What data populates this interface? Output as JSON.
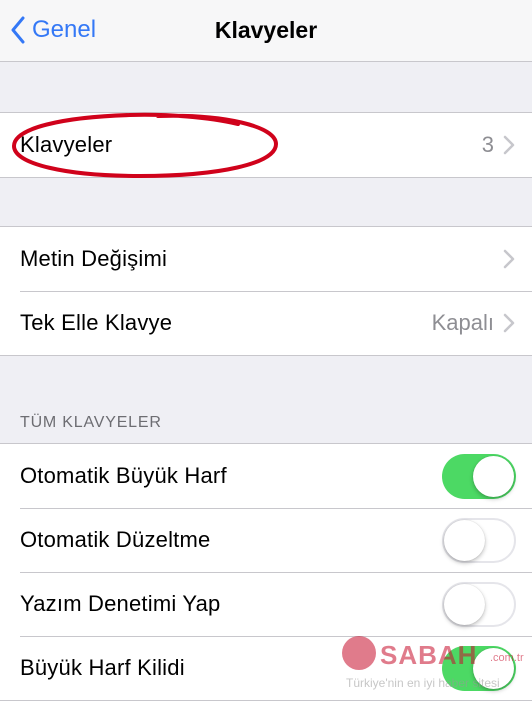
{
  "navbar": {
    "back_label": "Genel",
    "title": "Klavyeler"
  },
  "group1": {
    "rows": [
      {
        "label": "Klavyeler",
        "value": "3"
      }
    ]
  },
  "group2": {
    "rows": [
      {
        "label": "Metin Değişimi",
        "value": ""
      },
      {
        "label": "Tek Elle Klavye",
        "value": "Kapalı"
      }
    ]
  },
  "section_all": {
    "header": "TÜM KLAVYELER",
    "rows": [
      {
        "label": "Otomatik Büyük Harf",
        "toggle": "on"
      },
      {
        "label": "Otomatik Düzeltme",
        "toggle": "off"
      },
      {
        "label": "Yazım Denetimi Yap",
        "toggle": "off"
      },
      {
        "label": "Büyük Harf Kilidi",
        "toggle": "on"
      }
    ]
  },
  "watermark": {
    "brand": "SABAH",
    "suffix": ".com.tr",
    "tagline": "Türkiye'nin en iyi haber sitesi"
  },
  "colors": {
    "accent": "#3478f6",
    "toggle_on": "#4cd964",
    "annotation": "#d0021b",
    "background": "#efeff4"
  },
  "icons": {
    "back": "chevron-left-icon",
    "disclosure": "chevron-right-icon"
  }
}
